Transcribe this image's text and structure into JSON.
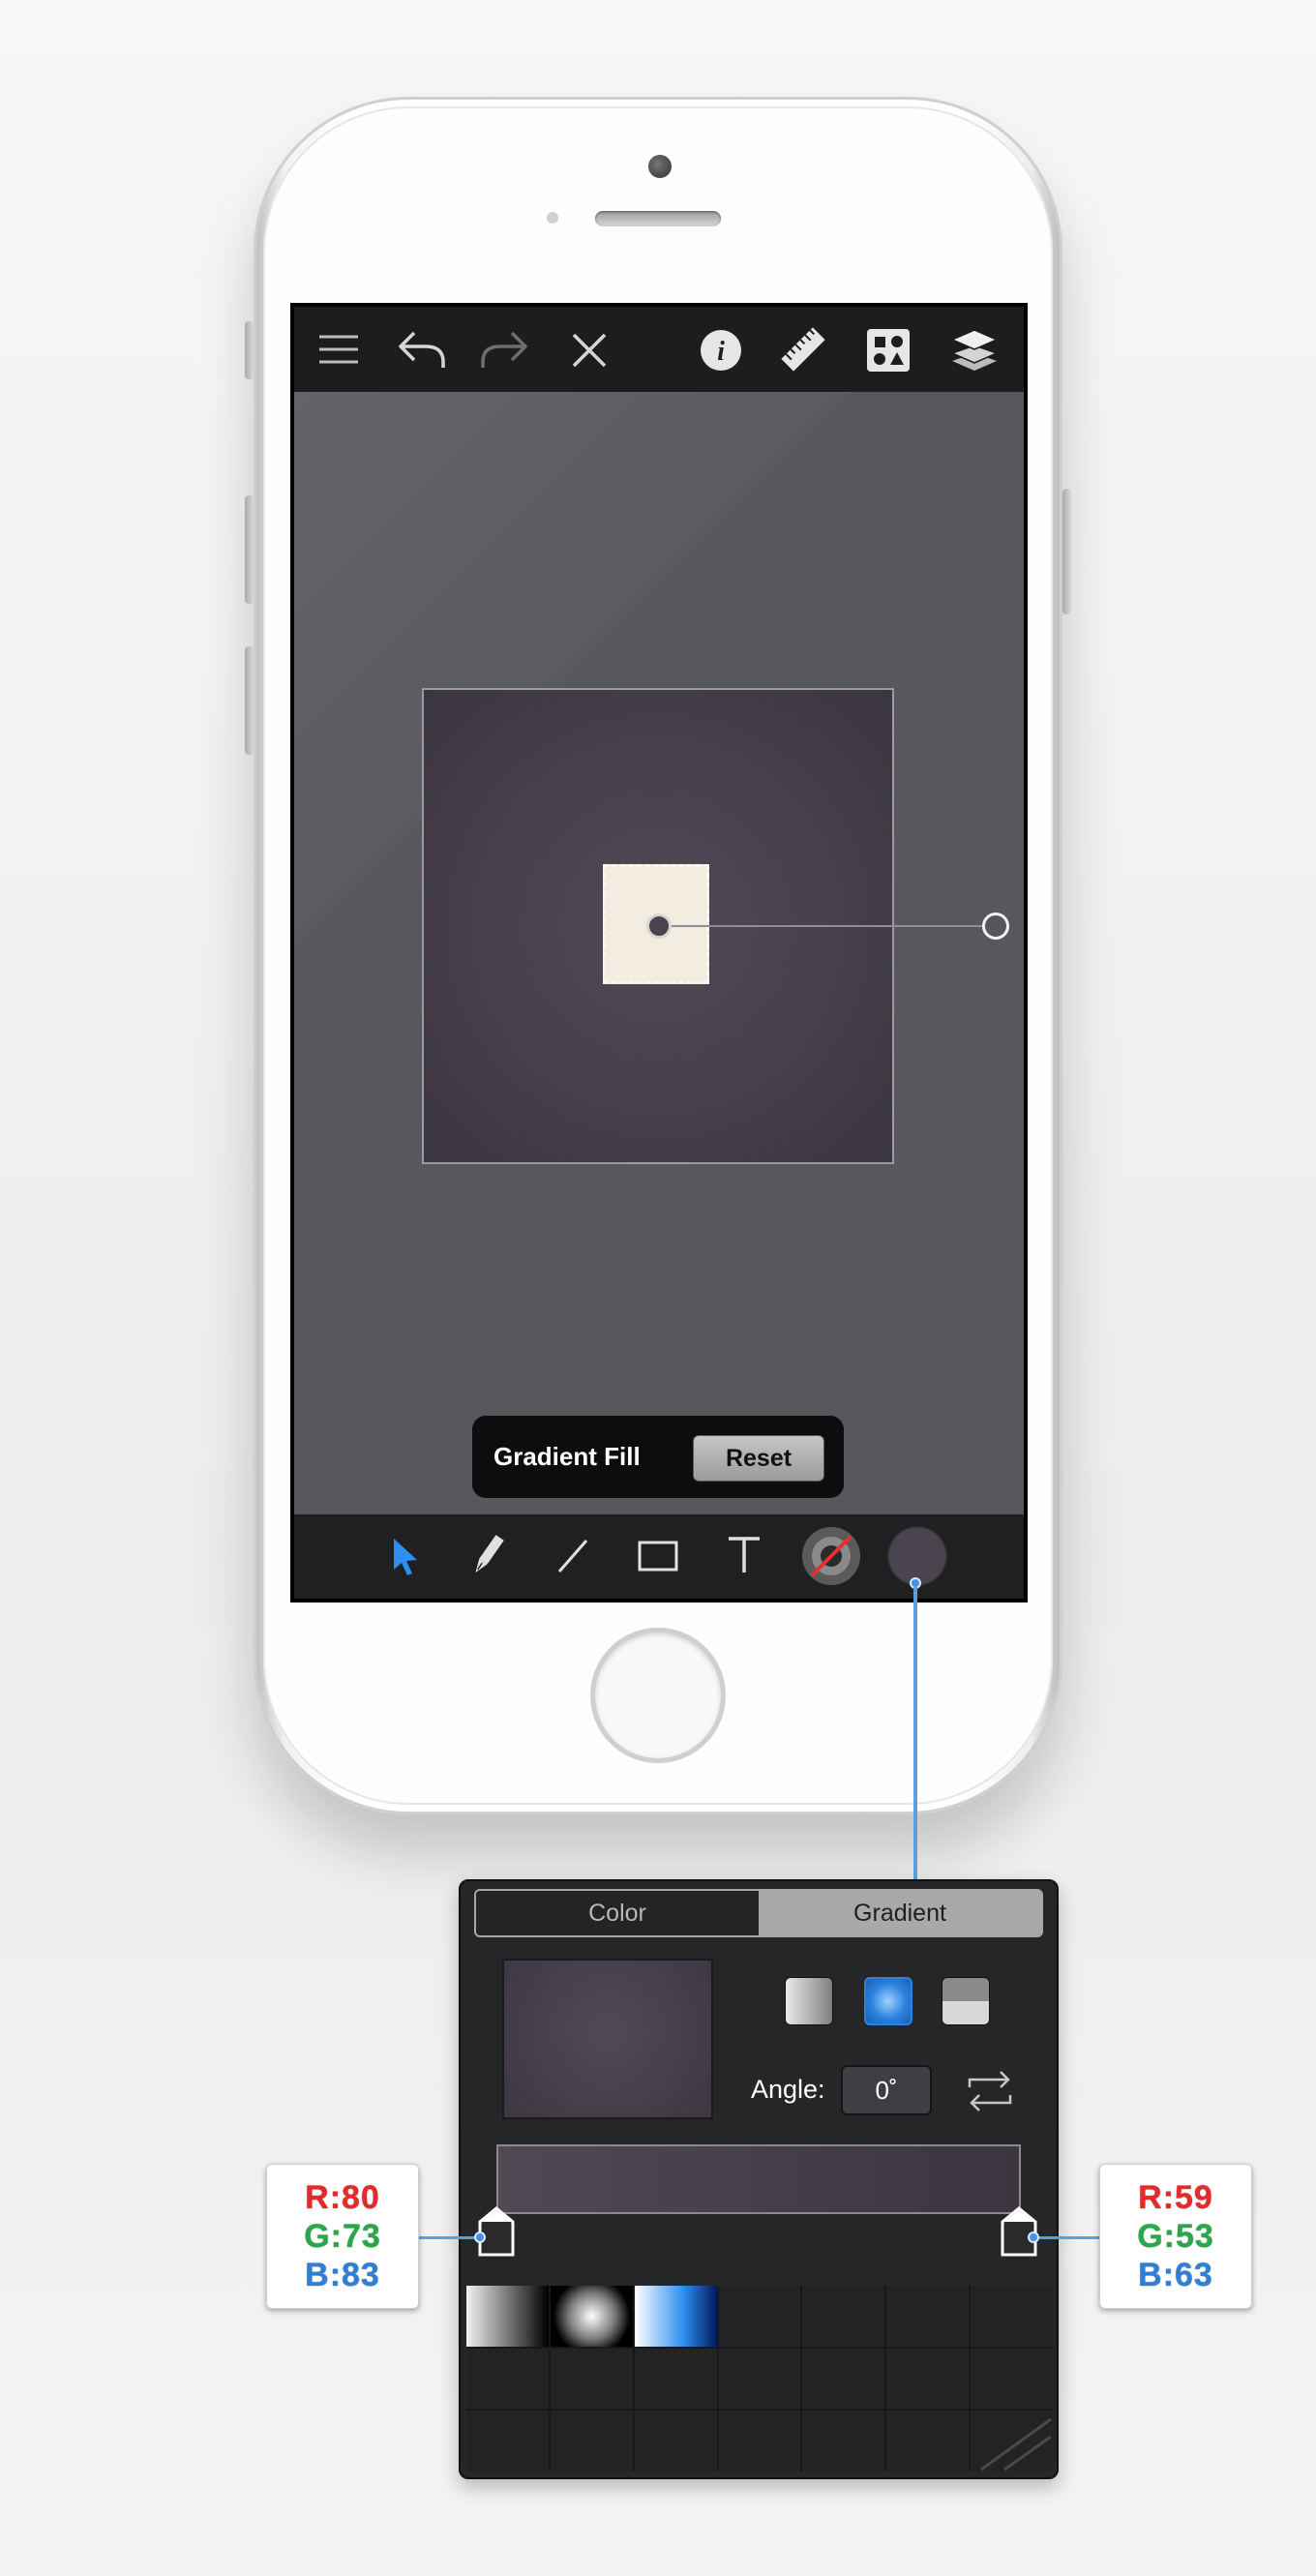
{
  "hud": {
    "label": "Gradient Fill",
    "reset_label": "Reset"
  },
  "toolbar": {
    "left_icons": [
      "menu-icon",
      "undo-icon",
      "redo-icon",
      "close-icon"
    ],
    "right_icons": [
      "info-icon",
      "ruler-icon",
      "shapes-icon",
      "layers-icon"
    ]
  },
  "tools": [
    "select-arrow-icon",
    "pen-icon",
    "line-icon",
    "rectangle-icon",
    "text-icon",
    "stroke-color-icon",
    "fill-color-icon"
  ],
  "colors": {
    "accent": "#4a90e2",
    "fill": "#4a4451",
    "canvas_bg": "#57585d",
    "stop_start": "#504953",
    "stop_end": "#3b353f"
  },
  "popover": {
    "tabs": [
      {
        "label": "Color",
        "selected": false
      },
      {
        "label": "Gradient",
        "selected": true
      }
    ],
    "angle_label": "Angle:",
    "angle_value": "0˚",
    "gradient_types": [
      "linear",
      "radial",
      "custom"
    ],
    "selected_type": "radial",
    "stops": [
      {
        "r_label": "R:80",
        "g_label": "G:73",
        "b_label": "B:83"
      },
      {
        "r_label": "R:59",
        "g_label": "G:53",
        "b_label": "B:63"
      }
    ],
    "presets": [
      "linear-gray",
      "radial-white",
      "linear-blue"
    ]
  }
}
